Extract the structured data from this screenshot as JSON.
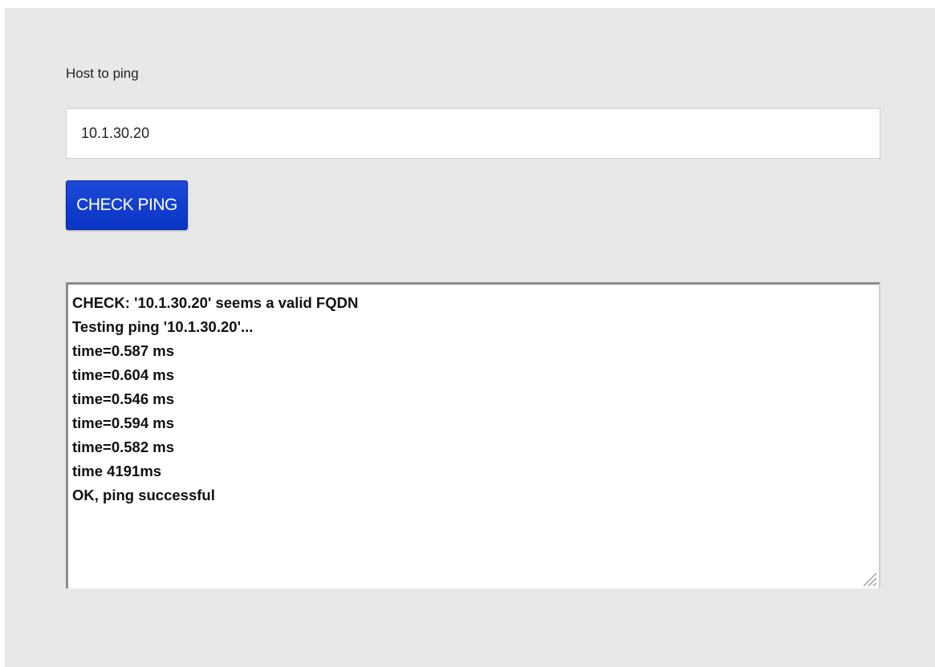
{
  "form": {
    "host_label": "Host to ping",
    "host_value": "10.1.30.20",
    "check_button_label": "CHECK PING"
  },
  "output": {
    "lines": [
      "CHECK: '10.1.30.20' seems a valid FQDN",
      "Testing ping '10.1.30.20'...",
      "time=0.587 ms",
      "time=0.604 ms",
      "time=0.546 ms",
      "time=0.594 ms",
      "time=0.582 ms",
      "time 4191ms",
      "OK, ping successful"
    ]
  },
  "icons": {
    "resize": "resize-grip-icon"
  },
  "colors": {
    "panel_background": "#e8e8e8",
    "button_accent": "#0b35c4"
  }
}
